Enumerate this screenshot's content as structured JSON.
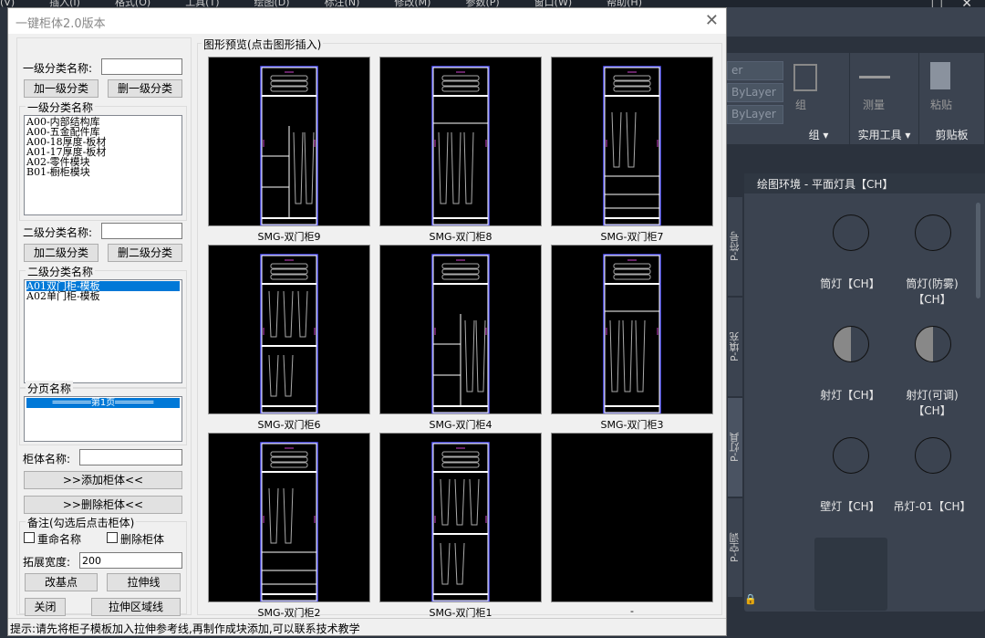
{
  "cad": {
    "menu": [
      "(V)",
      "插入(I)",
      "格式(O)",
      "工具(T)",
      "绘图(D)",
      "标注(N)",
      "修改(M)",
      "参数(P)",
      "窗口(W)",
      "帮助(H)"
    ],
    "window_controls": "_ □ ✕",
    "layer_values": [
      "er",
      "ByLayer",
      "ByLayer"
    ],
    "ribbon": {
      "group_label": "组 ▾",
      "group_btn": "组",
      "utility_label": "实用工具 ▾",
      "measure_btn": "测量",
      "clipboard_label": "剪贴板",
      "paste_btn": "粘贴"
    },
    "palette": {
      "title": "绘图环境 - 平面灯具【CH】",
      "tabs": [
        "P-符号",
        "P-填充",
        "P-灯具",
        "P-空调"
      ],
      "items": [
        "筒灯【CH】",
        "筒灯(防雾)【CH】",
        "射灯【CH】",
        "射灯(可调)【CH】",
        "壁灯【CH】",
        "吊灯-01【CH】"
      ]
    }
  },
  "dialog": {
    "title": "一键柜体2.0版本",
    "level1_label": "一级分类名称:",
    "level1_value": "",
    "add_level1": "加一级分类",
    "del_level1": "删一级分类",
    "level1_group": "一级分类名称",
    "level1_items": [
      "A00-内部结构库",
      "A00-五金配件库",
      "A00-18厚度-板材",
      "A01-17厚度-板材",
      "A02-零件模块",
      "B01-橱柜模块"
    ],
    "level2_label": "二级分类名称:",
    "level2_value": "",
    "add_level2": "加二级分类",
    "del_level2": "删二级分类",
    "level2_group": "二级分类名称",
    "level2_items": [
      "A01双门柜-模板",
      "A02单门柜-模板"
    ],
    "level2_selected": 0,
    "page_group": "分页名称",
    "page_items": [
      "═══════第1页═══════"
    ],
    "cabinet_name_label": "柜体名称:",
    "cabinet_name_value": "",
    "add_cabinet": ">>添加柜体<<",
    "del_cabinet": ">>删除柜体<<",
    "notes_group": "备注(勾选后点击柜体)",
    "rename_label": "重命名称",
    "rename_checked": false,
    "delete_label": "删除柜体",
    "delete_checked": false,
    "expand_label": "拓展宽度:",
    "expand_value": "200",
    "change_base": "改基点",
    "stretch_line": "拉伸线",
    "close": "关闭",
    "stretch_area": "拉伸区域线",
    "preview_group": "图形预览(点击图形插入)",
    "previews": [
      "SMG-双门柜9",
      "SMG-双门柜8",
      "SMG-双门柜7",
      "SMG-双门柜6",
      "SMG-双门柜4",
      "SMG-双门柜3",
      "SMG-双门柜2",
      "SMG-双门柜1",
      "-"
    ],
    "status": "提示:请先将柜子模板加入拉伸参考线,再制作成块添加,可以联系技术教学"
  }
}
